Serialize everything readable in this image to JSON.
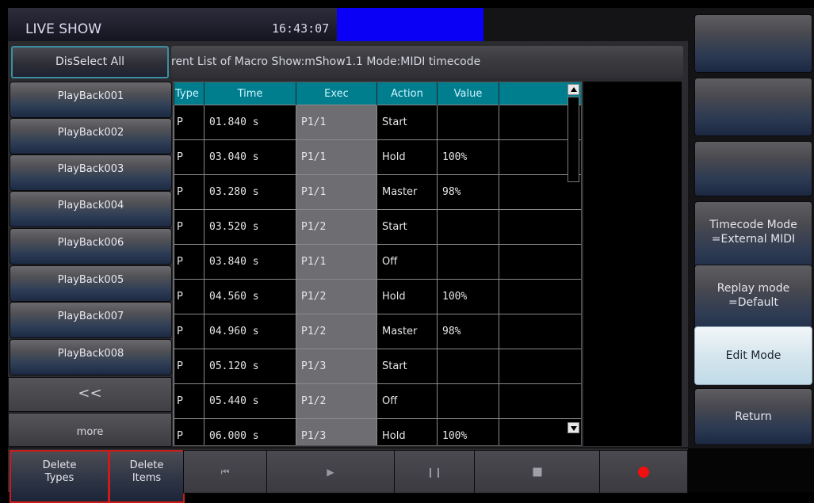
{
  "header": {
    "title": "LIVE SHOW",
    "clock": "16:43:07"
  },
  "disselect_label": "DisSelect All",
  "info_text": "rent List of Macro Show:mShow1.1  Mode:MIDI timecode",
  "playbacks": [
    "PlayBack001",
    "PlayBack002",
    "PlayBack003",
    "PlayBack004",
    "PlayBack006",
    "PlayBack005",
    "PlayBack007",
    "PlayBack008"
  ],
  "nav": {
    "prev_label": "<<",
    "more_label": "more"
  },
  "table": {
    "columns": [
      "Type",
      "Time",
      "Exec",
      "Action",
      "Value"
    ],
    "rows": [
      {
        "type": "P",
        "time": "01.840 s",
        "exec": "P1/1",
        "action": "Start",
        "value": ""
      },
      {
        "type": "P",
        "time": "03.040 s",
        "exec": "P1/1",
        "action": "Hold",
        "value": "100%"
      },
      {
        "type": "P",
        "time": "03.280 s",
        "exec": "P1/1",
        "action": "Master",
        "value": "98%"
      },
      {
        "type": "P",
        "time": "03.520 s",
        "exec": "P1/2",
        "action": "Start",
        "value": ""
      },
      {
        "type": "P",
        "time": "03.840 s",
        "exec": "P1/1",
        "action": "Off",
        "value": ""
      },
      {
        "type": "P",
        "time": "04.560 s",
        "exec": "P1/2",
        "action": "Hold",
        "value": "100%"
      },
      {
        "type": "P",
        "time": "04.960 s",
        "exec": "P1/2",
        "action": "Master",
        "value": "98%"
      },
      {
        "type": "P",
        "time": "05.120 s",
        "exec": "P1/3",
        "action": "Start",
        "value": ""
      },
      {
        "type": "P",
        "time": "05.440 s",
        "exec": "P1/2",
        "action": "Off",
        "value": ""
      },
      {
        "type": "P",
        "time": "06.000 s",
        "exec": "P1/3",
        "action": "Hold",
        "value": "100%"
      },
      {
        "type": "",
        "time": "",
        "exec": "",
        "action": "",
        "value": ""
      }
    ]
  },
  "right_panel": {
    "timecode_mode": [
      "Timecode Mode",
      "=External MIDI"
    ],
    "replay_mode": [
      "Replay mode",
      "=Default"
    ],
    "edit_mode": "Edit Mode",
    "return": "Return"
  },
  "bottom": {
    "delete_types": [
      "Delete",
      "Types"
    ],
    "delete_items": [
      "Delete",
      "Items"
    ]
  },
  "colors": {
    "accent_blue": "#0a00f5",
    "header_teal": "#007e8e",
    "record_red": "#f01010",
    "exec_gray": "#6e6e72"
  },
  "icons": [
    "skip-back-icon",
    "play-icon",
    "pause-icon",
    "stop-icon",
    "record-icon"
  ]
}
